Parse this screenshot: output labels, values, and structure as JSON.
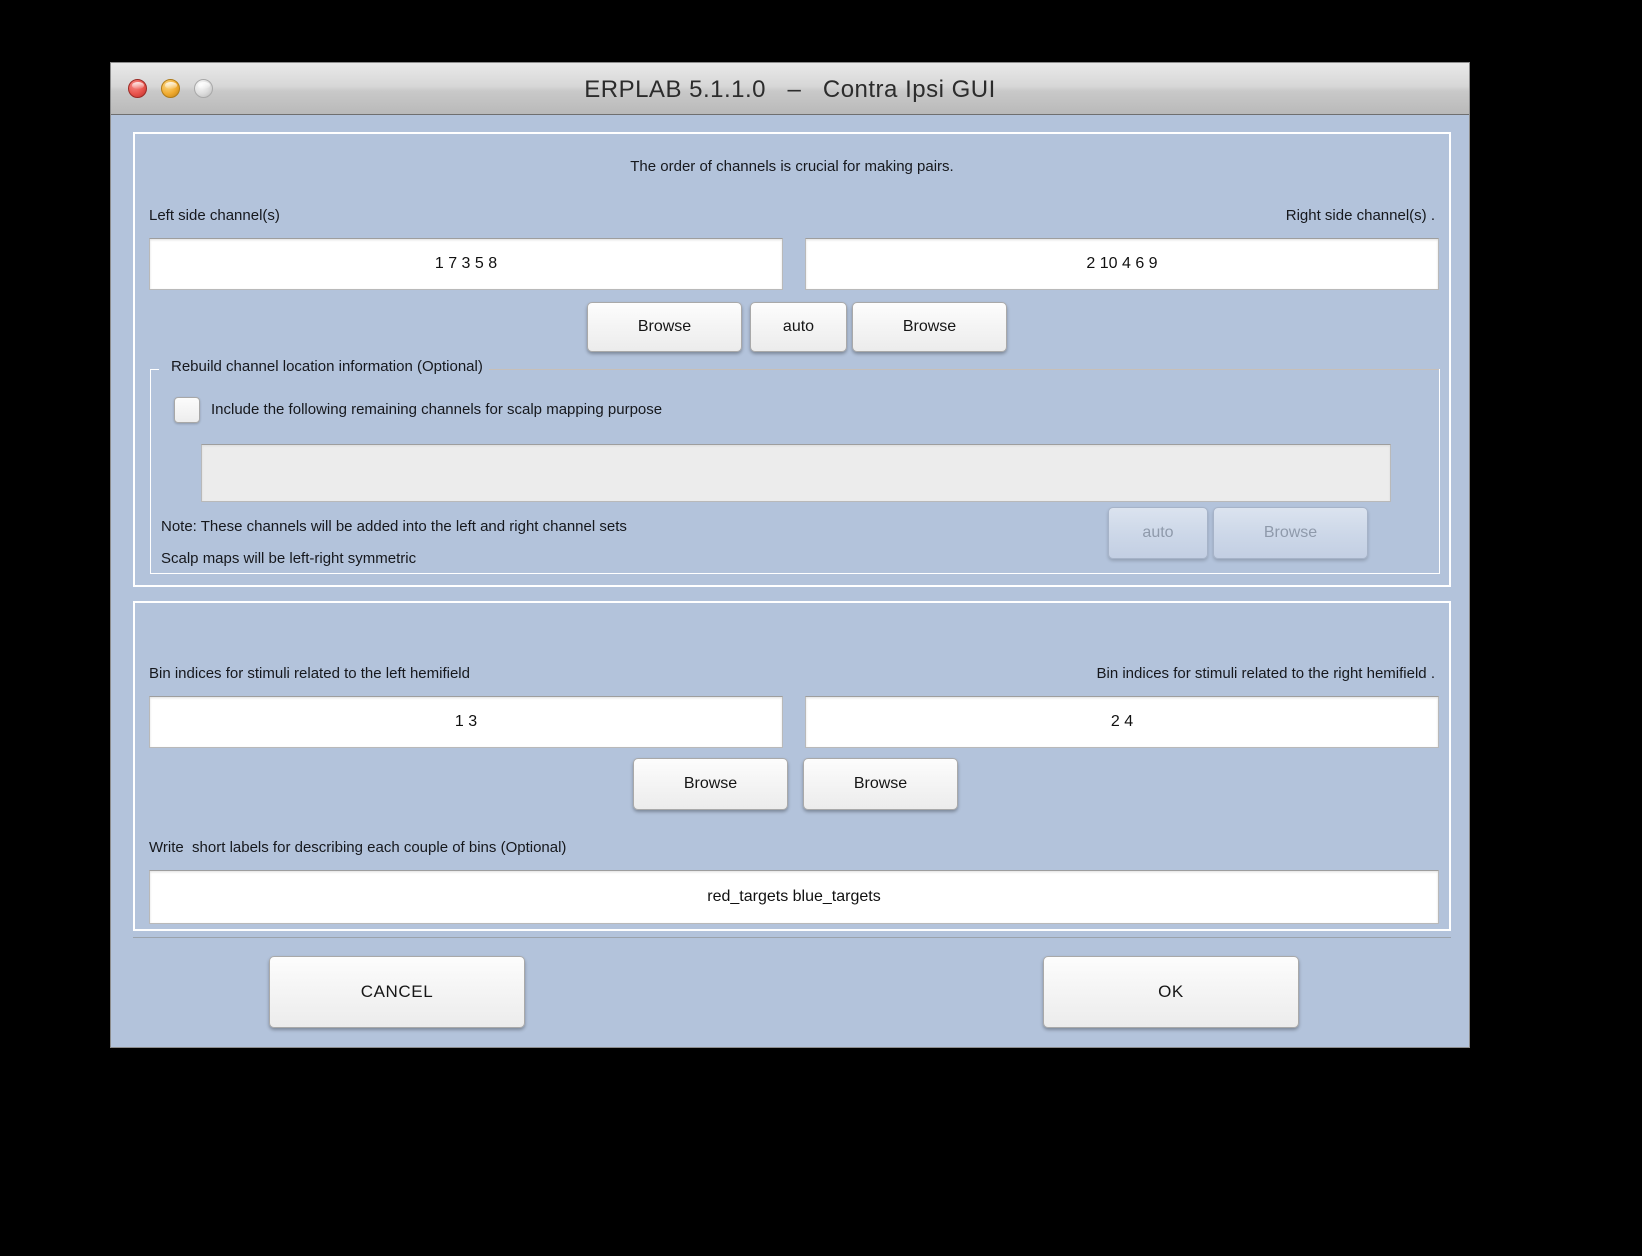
{
  "window": {
    "title": "ERPLAB 5.1.1.0   –   Contra Ipsi GUI",
    "traffic_lights": {
      "close": "close-button",
      "minimize": "minimize-button",
      "zoom": "zoom-button"
    },
    "colors": {
      "window_background": "#b3c3db",
      "titlebar": "#d7d7d7",
      "panel_border": "#ffffff",
      "text": "#16181d",
      "close_red": "#e8534c",
      "minimize_yellow": "#f0ab30",
      "zoom_gray": "#dcdcdc",
      "field_background": "#ffffff",
      "disabled_field_background": "#ececec"
    }
  },
  "channels_panel": {
    "hint": "The order of channels is crucial for making pairs.",
    "left_label": "Left side channel(s)",
    "right_label": "Right side channel(s) .",
    "left_value": "1 7 3 5 8",
    "right_value": "2 10 4 6 9",
    "buttons": {
      "browse_left": "Browse",
      "auto": "auto",
      "browse_right": "Browse"
    },
    "rebuild_group": {
      "title": "Rebuild channel location information (Optional)",
      "checkbox_label": "Include the following remaining channels for scalp mapping purpose",
      "checkbox_checked": false,
      "remaining_value": "",
      "note_line1": "Note: These channels will be added into the left and right channel sets",
      "note_line2": "Scalp maps will be left-right symmetric",
      "auto_label": "auto",
      "browse_label": "Browse",
      "auto_enabled": false,
      "browse_enabled": false
    }
  },
  "bins_panel": {
    "left_label": "Bin indices for stimuli related to the left hemifield",
    "right_label": "Bin indices for stimuli related to the right hemifield .",
    "left_value": "1 3",
    "right_value": "2 4",
    "browse_left": "Browse",
    "browse_right": "Browse",
    "labels_caption": "Write  short labels for describing each couple of bins (Optional)",
    "labels_value": "red_targets blue_targets"
  },
  "footer": {
    "cancel": "CANCEL",
    "ok": "OK"
  }
}
